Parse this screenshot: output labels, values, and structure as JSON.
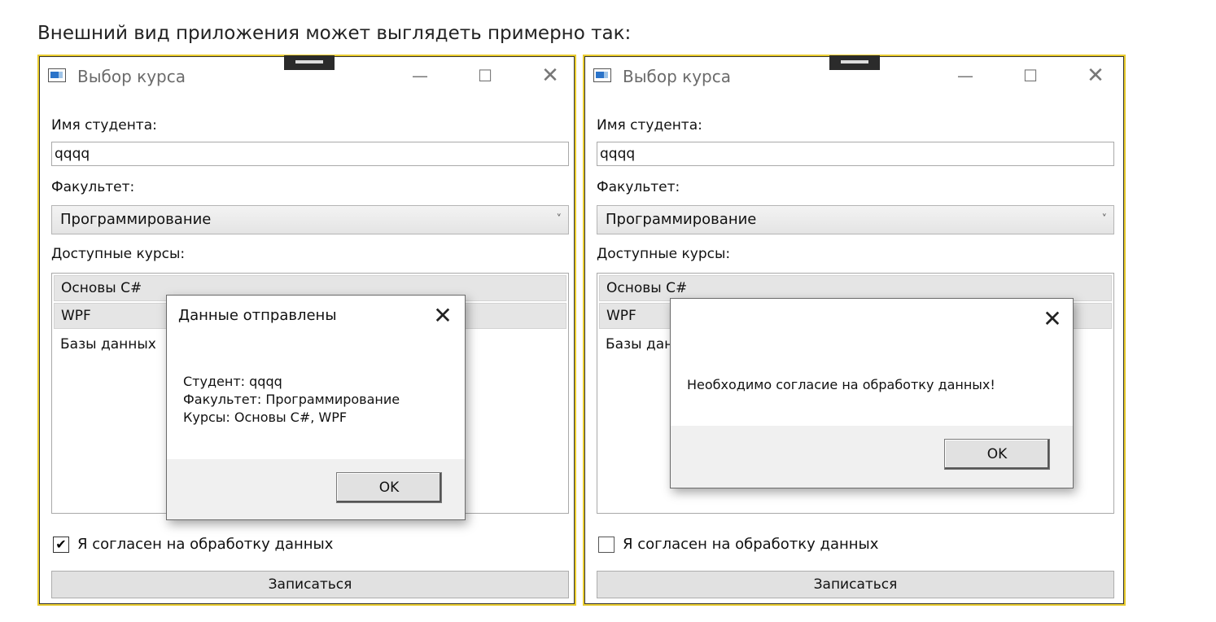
{
  "intro_text": "Внешний вид приложения может выглядеть примерно так:",
  "windows": [
    {
      "title": "Выбор курса",
      "controls": {
        "minimize": "—",
        "maximize": "☐",
        "close": "✕"
      },
      "student_label": "Имя студента:",
      "student_value": "qqqq",
      "faculty_label": "Факультет:",
      "faculty_value": "Программирование",
      "courses_label": "Доступные курсы:",
      "courses": [
        "Основы C#",
        "WPF",
        "Базы данных"
      ],
      "consent_label": "Я согласен на обработку данных",
      "consent_checked": true,
      "check_mark": "✔",
      "submit_label": "Записаться",
      "dialog": {
        "title": "Данные отправлены",
        "close": "✕",
        "message": "Студент: qqqq\nФакультет: Программирование\nКурсы: Основы C#, WPF",
        "ok_label": "OK"
      }
    },
    {
      "title": "Выбор курса",
      "controls": {
        "minimize": "—",
        "maximize": "☐",
        "close": "✕"
      },
      "student_label": "Имя студента:",
      "student_value": "qqqq",
      "faculty_label": "Факультет:",
      "faculty_value": "Программирование",
      "courses_label": "Доступные курсы:",
      "courses": [
        "Основы C#",
        "WPF",
        "Базы дан"
      ],
      "consent_label": "Я согласен на обработку данных",
      "consent_checked": false,
      "check_mark": "",
      "submit_label": "Записаться",
      "dialog": {
        "title": "",
        "close": "✕",
        "message": "Необходимо согласие на обработку данных!",
        "ok_label": "OK"
      }
    }
  ],
  "combo_arrow": "˅",
  "colors": {
    "window_border": "#e8cb2e",
    "selection": "#e5e5e5",
    "dialog_footer": "#f0f0f0"
  }
}
